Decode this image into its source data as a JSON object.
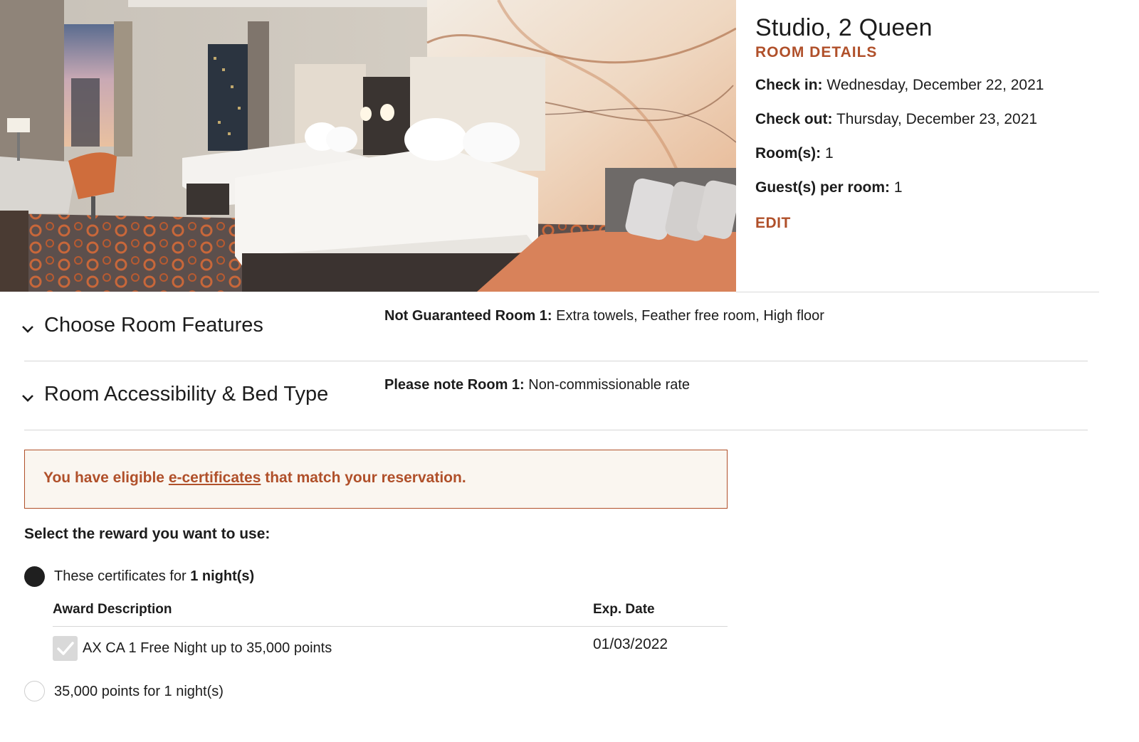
{
  "hero": {
    "image_alt": "Studio room with two queen beds"
  },
  "room": {
    "title": "Studio, 2 Queen",
    "details_label": "ROOM DETAILS",
    "check_in_label": "Check in:",
    "check_in_value": "Wednesday, December 22, 2021",
    "check_out_label": "Check out:",
    "check_out_value": "Thursday, December 23, 2021",
    "rooms_label": "Room(s):",
    "rooms_value": "1",
    "guests_label": "Guest(s) per room:",
    "guests_value": "1",
    "edit_label": "EDIT"
  },
  "accordions": [
    {
      "title": "Choose Room Features",
      "note_label": "Not Guaranteed Room 1:",
      "note_value": "Extra towels, Feather free room, High floor",
      "icon": "chevron-down-icon"
    },
    {
      "title": "Room Accessibility & Bed Type",
      "note_label": "Please note Room 1:",
      "note_value": "Non-commissionable rate",
      "icon": "chevron-down-icon"
    }
  ],
  "banner": {
    "text_before": "You have eligible ",
    "link_text": "e-certificates",
    "text_after": " that match your reservation."
  },
  "rewards": {
    "prompt": "Select the reward you want to use:",
    "option1_prefix": "These certificates for ",
    "option1_bold": "1 night(s)",
    "option1_selected": true,
    "table_header_description": "Award Description",
    "table_header_date": "Exp. Date",
    "award_description": "AX CA 1 Free Night up to 35,000 points",
    "award_exp_date": "01/03/2022",
    "award_checked": true,
    "option2_label": "35,000 points for 1 night(s)",
    "option2_selected": false
  },
  "colors": {
    "accent": "#b0502a",
    "banner_bg": "#faf6f0",
    "text": "#1c1c1c",
    "radio_on": "#1f1f1f"
  }
}
